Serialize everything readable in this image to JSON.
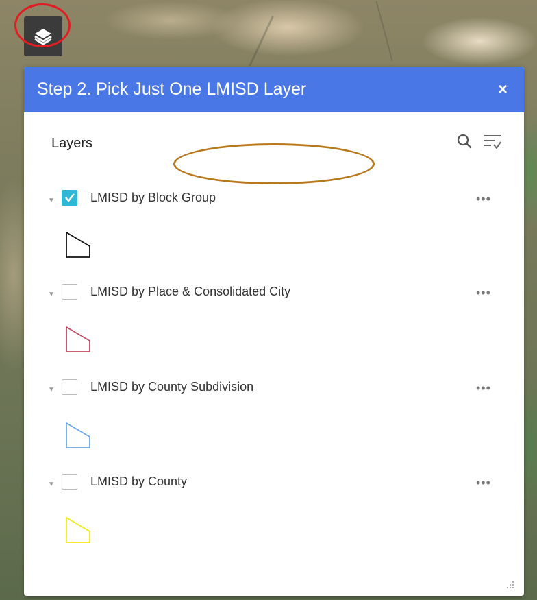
{
  "panel": {
    "title": "Step 2. Pick Just One LMISD Layer",
    "close_label": "×"
  },
  "layers_section": {
    "title": "Layers"
  },
  "layers": [
    {
      "label": "LMISD by Block Group",
      "checked": true,
      "color": "#111111"
    },
    {
      "label": "LMISD by Place & Consolidated City",
      "checked": false,
      "color": "#c44a64"
    },
    {
      "label": "LMISD by County Subdivision",
      "checked": false,
      "color": "#6aa8e8"
    },
    {
      "label": "LMISD by County",
      "checked": false,
      "color": "#f2ea16"
    }
  ],
  "more_label": "•••",
  "colors": {
    "header": "#4a77e6",
    "checked": "#2fb7d6",
    "highlight_red": "#e31b23",
    "highlight_gold": "#b8791c"
  }
}
